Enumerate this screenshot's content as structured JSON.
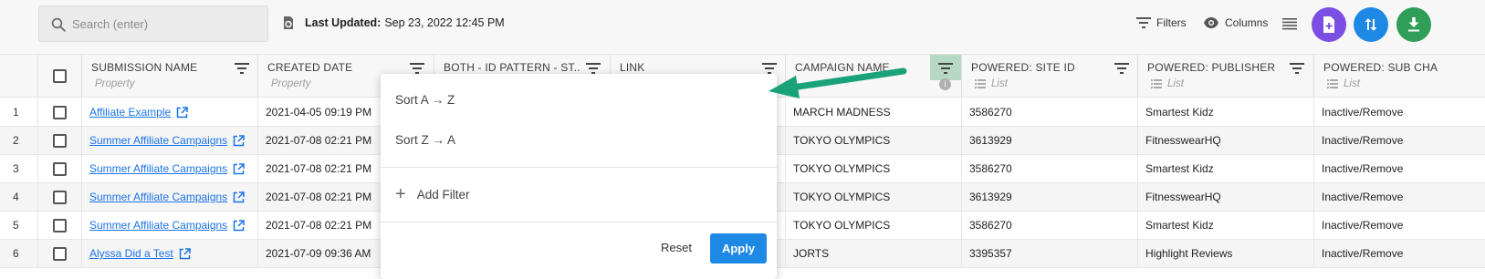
{
  "search": {
    "placeholder": "Search (enter)"
  },
  "last_updated": {
    "label": "Last Updated:",
    "value": "Sep 23, 2022 12:45 PM"
  },
  "toolbar": {
    "filters_label": "Filters",
    "columns_label": "Columns",
    "colors": {
      "purple": "#7b4ee4",
      "blue": "#1e88e5",
      "green": "#2e9e58"
    }
  },
  "columns": [
    {
      "title": "SUBMISSION NAME",
      "subtitle": "Property"
    },
    {
      "title": "CREATED DATE",
      "subtitle": "Property"
    },
    {
      "title": "BOTH - ID PATTERN - ST...",
      "subtitle": ""
    },
    {
      "title": "LINK",
      "subtitle": ""
    },
    {
      "title": "CAMPAIGN NAME",
      "subtitle": ""
    },
    {
      "title": "POWERED: SITE ID",
      "subtitle": "List"
    },
    {
      "title": "POWERED: PUBLISHER",
      "subtitle": "List"
    },
    {
      "title": "POWERED: SUB CHA",
      "subtitle": "List"
    }
  ],
  "rows": [
    {
      "num": "1",
      "submission": "Affiliate Example",
      "created": "2021-04-05 09:19 PM",
      "campaign": "MARCH MADNESS",
      "site_id": "3586270",
      "publisher": "Smartest Kidz",
      "sub": "Inactive/Remove"
    },
    {
      "num": "2",
      "submission": "Summer Affiliate Campaigns",
      "created": "2021-07-08 02:21 PM",
      "campaign": "TOKYO OLYMPICS",
      "site_id": "3613929",
      "publisher": "FitnesswearHQ",
      "sub": "Inactive/Remove"
    },
    {
      "num": "3",
      "submission": "Summer Affiliate Campaigns",
      "created": "2021-07-08 02:21 PM",
      "campaign": "TOKYO OLYMPICS",
      "site_id": "3586270",
      "publisher": "Smartest Kidz",
      "sub": "Inactive/Remove"
    },
    {
      "num": "4",
      "submission": "Summer Affiliate Campaigns",
      "created": "2021-07-08 02:21 PM",
      "campaign": "TOKYO OLYMPICS",
      "site_id": "3613929",
      "publisher": "FitnesswearHQ",
      "sub": "Inactive/Remove"
    },
    {
      "num": "5",
      "submission": "Summer Affiliate Campaigns",
      "created": "2021-07-08 02:21 PM",
      "campaign": "TOKYO OLYMPICS",
      "site_id": "3586270",
      "publisher": "Smartest Kidz",
      "sub": "Inactive/Remove"
    },
    {
      "num": "6",
      "submission": "Alyssa Did a Test",
      "created": "2021-07-09 09:36 AM",
      "campaign": "JORTS",
      "site_id": "3395357",
      "publisher": "Highlight Reviews",
      "sub": "Inactive/Remove"
    }
  ],
  "menu": {
    "sort_az": "Sort A → Z",
    "sort_za": "Sort Z → A",
    "add_filter": "Add Filter",
    "reset": "Reset",
    "apply": "Apply"
  },
  "accent": {
    "link": "#1a73e8",
    "filter_active": "#b7d9c4",
    "arrow": "#1aa37a"
  }
}
